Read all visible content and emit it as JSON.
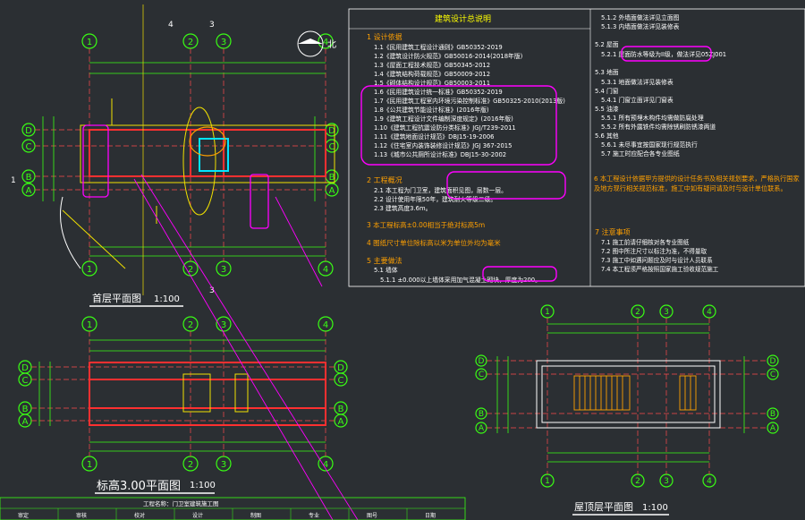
{
  "colors": {
    "background": "#2b2f33",
    "axis_circle": "#39ff14",
    "wall": "#ff3030",
    "grid_line": "#ff4b4b",
    "dimension": "#f0e000",
    "markup": "#ff00ff",
    "text_white": "#ffffff",
    "cyan": "#00e5ff",
    "orange": "#ffa000"
  },
  "drawing": {
    "north_label": "北",
    "plan1_title": "首层平面图",
    "plan1_scale": "1:100",
    "plan2_title": "标高3.00平面图",
    "plan2_scale": "1:100",
    "plan3_title": "屋顶层平面图",
    "plan3_scale": "1:100",
    "axis_numbers": [
      "1",
      "2",
      "3",
      "4"
    ],
    "axis_letters": [
      "A",
      "B",
      "C",
      "D"
    ],
    "section_marks": [
      "4",
      "3",
      "2",
      "1"
    ]
  },
  "notes": {
    "title": "建筑设计总说明",
    "section1_head": "1  设计依据",
    "section1_items": [
      "1.1《民用建筑工程设计通则》GB50352-2019",
      "1.2《建筑设计防火规范》GB50016-2014(2018年版)",
      "1.3《屋面工程技术规范》GB50345-2012",
      "1.4《建筑结构荷载规范》GB50009-2012",
      "1.5《砌体结构设计规范》GB50003-2011",
      "1.6《民用建筑设计统一标准》GB50352-2019",
      "1.7《民用建筑工程室内环境污染控制标准》GB50325-2010(2013版)",
      "1.8《公共建筑节能设计标准》(2016年版)",
      "1.9《建筑工程设计文件编制深度规定》(2016年版)",
      "1.10《建筑工程抗震设防分类标准》JGJ/T239-2011",
      "1.11《建筑地面设计规范》DBJ15-19-2006",
      "1.12《住宅室内装饰装修设计规范》JGJ 367-2015",
      "1.13《城市公共厕所设计标准》DBJ15-30-2002"
    ],
    "section2_head": "2  工程概况",
    "section2_items": [
      "2.1 本工程为门卫室，建筑面积见图，层数一层。",
      "2.2 设计使用年限50年，建筑耐火等级二级。",
      "2.3 建筑高度3.6m。"
    ],
    "section3_head": "3  本工程标高±0.00相当于绝对标高5m",
    "section4_head": "4  图纸尺寸单位除标高以米为单位外均为毫米",
    "section5_head": "5  主要做法",
    "section5_items": [
      "5.1 墙体",
      "5.1.1 ±0.000以上墙体采用加气混凝土砌块，厚度为200。"
    ],
    "right_top_items": [
      "5.1.2 外墙面做法详见立面图",
      "5.1.3 内墙面做法详见装修表",
      "5.2 屋面",
      "5.2.1 屋面防水等级为II级，做法详见05ZJ001",
      "5.3 地面",
      "5.3.1 地面做法详见装修表",
      "5.4 门窗",
      "5.4.1 门窗立面详见门窗表",
      "5.5 油漆",
      "5.5.1 所有预埋木构件均需做防腐处理",
      "5.5.2 所有外露铁件均需除锈刷防锈漆两道",
      "5.6 其他",
      "5.6.1 未尽事宜按国家现行规范执行",
      "5.7 施工时应配合各专业图纸"
    ],
    "section6_head": "6  本工程设计依据甲方提供的设计任务书及相关规划要求，严格执行国家及地方现行相关规范标准，施工中如有疑问请及时与设计单位联系。",
    "section7_head": "7  注意事项",
    "section7_items": [
      "7.1 施工前请仔细核对各专业图纸",
      "7.2 图中所注尺寸以标注为准，不得量取",
      "7.3 施工中如遇问题应及时与设计人员联系",
      "7.4 本工程须严格按照国家施工验收规范施工"
    ]
  },
  "title_block": {
    "project_line": "工程名称：门卫室建筑施工图",
    "cells": [
      "审定",
      "审核",
      "校对",
      "设计",
      "制图",
      "专业",
      "图号",
      "日期"
    ]
  }
}
